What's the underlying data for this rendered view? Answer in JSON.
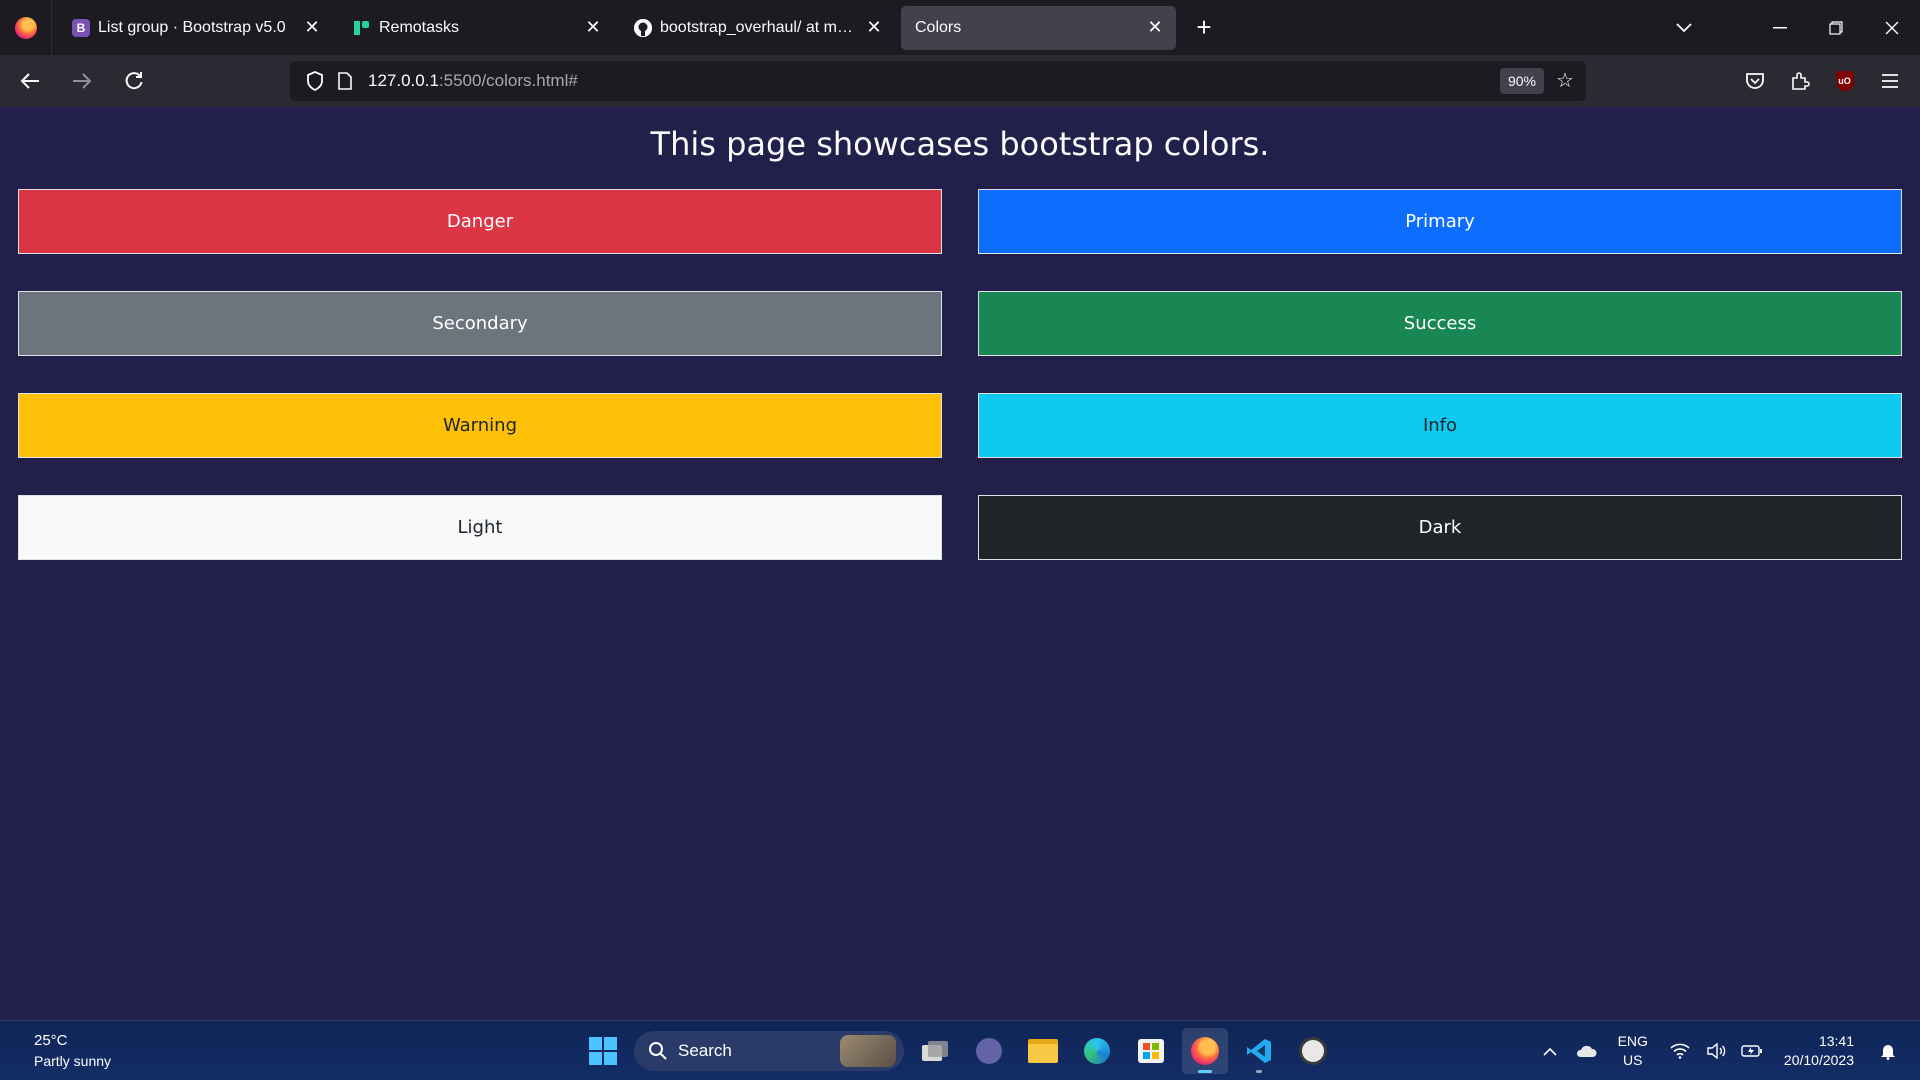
{
  "browser": {
    "tabs": [
      {
        "title": "List group · Bootstrap v5.0",
        "favicon": "bootstrap-icon",
        "active": false
      },
      {
        "title": "Remotasks",
        "favicon": "remotasks-icon",
        "active": false
      },
      {
        "title": "bootstrap_overhaul/ at main · M",
        "favicon": "github-icon",
        "active": false
      },
      {
        "title": "Colors",
        "favicon": "none",
        "active": true
      }
    ],
    "url_host": "127.0.0.1",
    "url_path": ":5500/colors.html#",
    "zoom": "90%"
  },
  "page": {
    "heading": "This page showcases bootstrap colors.",
    "colors": [
      {
        "label": "Danger",
        "bg": "#dc3545",
        "fg": "#ffffff"
      },
      {
        "label": "Primary",
        "bg": "#0d6efd",
        "fg": "#ffffff"
      },
      {
        "label": "Secondary",
        "bg": "#6c757d",
        "fg": "#ffffff"
      },
      {
        "label": "Success",
        "bg": "#198754",
        "fg": "#ffffff"
      },
      {
        "label": "Warning",
        "bg": "#ffc107",
        "fg": "#212529"
      },
      {
        "label": "Info",
        "bg": "#0dcaf0",
        "fg": "#212529"
      },
      {
        "label": "Light",
        "bg": "#f8f9fa",
        "fg": "#212529"
      },
      {
        "label": "Dark",
        "bg": "#212529",
        "fg": "#ffffff"
      }
    ],
    "background": "#22204a"
  },
  "taskbar": {
    "weather_temp": "25°C",
    "weather_desc": "Partly sunny",
    "search_label": "Search",
    "lang_line1": "ENG",
    "lang_line2": "US",
    "time": "13:41",
    "date": "20/10/2023"
  }
}
